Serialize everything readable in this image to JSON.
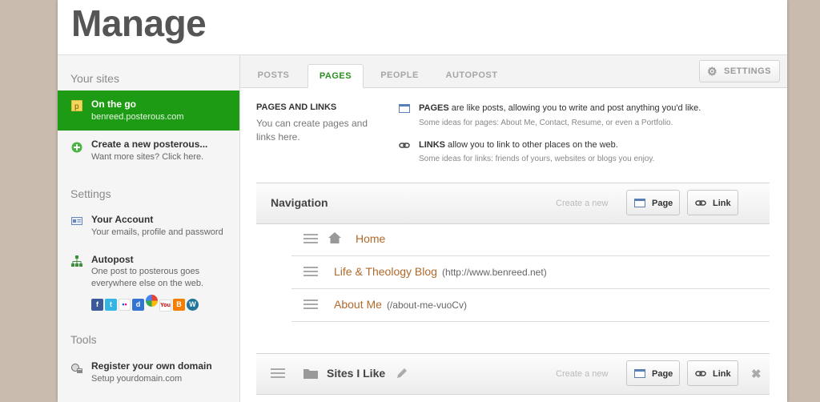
{
  "page": {
    "title": "Manage"
  },
  "sidebar": {
    "your_sites_heading": "Your sites",
    "sites": [
      {
        "title": "On the go",
        "subtitle": "benreed.posterous.com"
      },
      {
        "title": "Create a new posterous...",
        "subtitle": "Want more sites? Click here."
      }
    ],
    "settings_heading": "Settings",
    "settings_items": [
      {
        "title": "Your Account",
        "subtitle": "Your emails, profile and password"
      },
      {
        "title": "Autopost",
        "subtitle": "One post to posterous goes everywhere else on the web."
      }
    ],
    "social_services": [
      "facebook-icon",
      "twitter-icon",
      "flickr-icon",
      "delicious-icon",
      "picasa-icon",
      "youtube-icon",
      "blogger-icon",
      "wordpress-icon"
    ],
    "tools_heading": "Tools",
    "tools_items": [
      {
        "title": "Register your own domain",
        "subtitle": "Setup yourdomain.com"
      }
    ]
  },
  "tabs": [
    {
      "label": "POSTS",
      "active": false
    },
    {
      "label": "PAGES",
      "active": true
    },
    {
      "label": "PEOPLE",
      "active": false
    },
    {
      "label": "AUTOPOST",
      "active": false
    }
  ],
  "settings_button": {
    "label": "SETTINGS"
  },
  "intro": {
    "heading": "PAGES AND LINKS",
    "text": "You can create pages and links here.",
    "pages_info": {
      "term": "PAGES",
      "text": " are like posts, allowing you to write and post anything you'd like.",
      "ideas": "Some ideas for pages: About Me, Contact, Resume, or even a Portfolio."
    },
    "links_info": {
      "term": "LINKS",
      "text": " allow you to link to other places on the web.",
      "ideas": "Some ideas for links: friends of yours, websites or blogs you enjoy."
    }
  },
  "navigation": {
    "title": "Navigation",
    "create_label": "Create a new",
    "page_button": "Page",
    "link_button": "Link",
    "items": [
      {
        "label": "Home",
        "url": ""
      },
      {
        "label": "Life & Theology Blog",
        "url": "(http://www.benreed.net)"
      },
      {
        "label": "About Me",
        "url": "(/about-me-vuoCv)"
      }
    ]
  },
  "sites_i_like": {
    "title": "Sites I Like",
    "create_label": "Create a new",
    "page_button": "Page",
    "link_button": "Link"
  },
  "colors": {
    "accent_green": "#1d9b14",
    "link_orange": "#b06a2c",
    "tab_active": "#2b8f20"
  }
}
